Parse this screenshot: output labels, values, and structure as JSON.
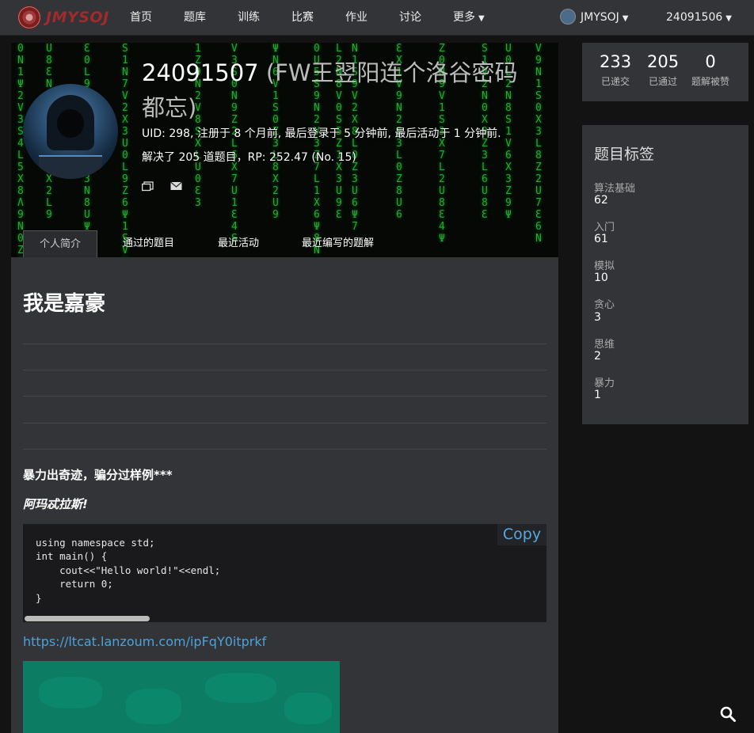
{
  "brand": {
    "logo_text": "JMYSOJ",
    "accent": "#a12a2a"
  },
  "nav": {
    "items": [
      "首页",
      "题库",
      "训练",
      "比赛",
      "作业",
      "讨论"
    ],
    "more": "更多",
    "user_name": "JMYSOJ",
    "account": "24091506"
  },
  "profile": {
    "username": "24091507",
    "nickname": "(FW王翌阳连个洛谷密码都忘)",
    "meta_line": "UID: 298, 注册于 8 个月前, 最后登录于 5 分钟前, 最后活动于 1 分钟前.",
    "stats_line": "解决了 205 道题目，RP: 252.47 (No. 15)",
    "icons": [
      "message-icon",
      "mail-icon"
    ],
    "tabs": [
      "个人简介",
      "通过的题目",
      "最近活动",
      "最近编写的题解"
    ]
  },
  "bio": {
    "heading": "我是嘉豪",
    "bold_line": "暴力出奇迹，骗分过样例***",
    "italic_line": "阿玛忒拉斯!",
    "code": "using namespace std;\nint main() {\n    cout<<\"Hello world!\"<<endl;\n    return 0;\n}",
    "copy_label": "Copy",
    "link": "https://ltcat.lanzoum.com/ipFqY0itprkf"
  },
  "stats": [
    {
      "value": "233",
      "label": "已递交"
    },
    {
      "value": "205",
      "label": "已通过"
    },
    {
      "value": "0",
      "label": "题解被赞"
    }
  ],
  "tags": {
    "title": "题目标签",
    "items": [
      {
        "name": "算法基础",
        "count": "62"
      },
      {
        "name": "入门",
        "count": "61"
      },
      {
        "name": "模拟",
        "count": "10"
      },
      {
        "name": "贪心",
        "count": "3"
      },
      {
        "name": "思维",
        "count": "2"
      },
      {
        "name": "暴力",
        "count": "1"
      }
    ]
  }
}
